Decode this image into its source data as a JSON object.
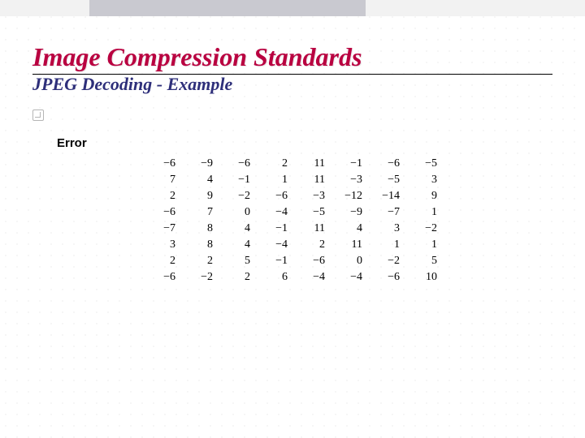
{
  "slide": {
    "title": "Image Compression Standards",
    "subtitle": "JPEG Decoding - Example",
    "label": "Error"
  },
  "chart_data": {
    "type": "table",
    "title": "Error",
    "rows": [
      [
        -6,
        -9,
        -6,
        2,
        11,
        -1,
        -6,
        -5
      ],
      [
        7,
        4,
        -1,
        1,
        11,
        -3,
        -5,
        3
      ],
      [
        2,
        9,
        -2,
        -6,
        -3,
        -12,
        -14,
        9
      ],
      [
        -6,
        7,
        0,
        -4,
        -5,
        -9,
        -7,
        1
      ],
      [
        -7,
        8,
        4,
        -1,
        11,
        4,
        3,
        -2
      ],
      [
        3,
        8,
        4,
        -4,
        2,
        11,
        1,
        1
      ],
      [
        2,
        2,
        5,
        -1,
        -6,
        0,
        -2,
        5
      ],
      [
        -6,
        -2,
        2,
        6,
        -4,
        -4,
        -6,
        10
      ]
    ]
  }
}
